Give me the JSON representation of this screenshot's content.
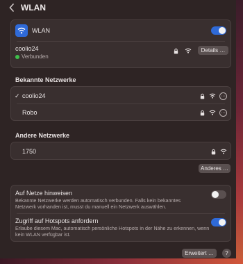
{
  "header": {
    "title": "WLAN"
  },
  "wlan_toggle": {
    "label": "WLAN",
    "state": "on"
  },
  "current": {
    "name": "coolio24",
    "status": "Verbunden",
    "details_button": "Details …"
  },
  "known": {
    "title": "Bekannte Netzwerke",
    "items": [
      {
        "check": "✓",
        "name": "coolio24"
      },
      {
        "name": "Robo"
      }
    ]
  },
  "other": {
    "title": "Andere Netzwerke",
    "items": [
      {
        "name": "1750"
      }
    ],
    "button": "Anderes …"
  },
  "settings": {
    "ask_join": {
      "title": "Auf Netze hinweisen",
      "desc": "Bekannte Netzwerke werden automatisch verbunden. Falls kein bekanntes Netzwerk vorhanden ist, musst du manuell ein Netzwerk auswählen.",
      "state": "off"
    },
    "hotspot": {
      "title": "Zugriff auf Hotspots anfordern",
      "desc": "Erlaube diesem Mac, automatisch persönliche Hotspots in der Nähe zu erkennen, wenn kein WLAN verfügbar ist.",
      "state": "on"
    }
  },
  "footer": {
    "advanced_button": "Erweitert …",
    "help": "?"
  },
  "colors": {
    "accent": "#2f6ad8",
    "status_green": "#3ec04b"
  }
}
